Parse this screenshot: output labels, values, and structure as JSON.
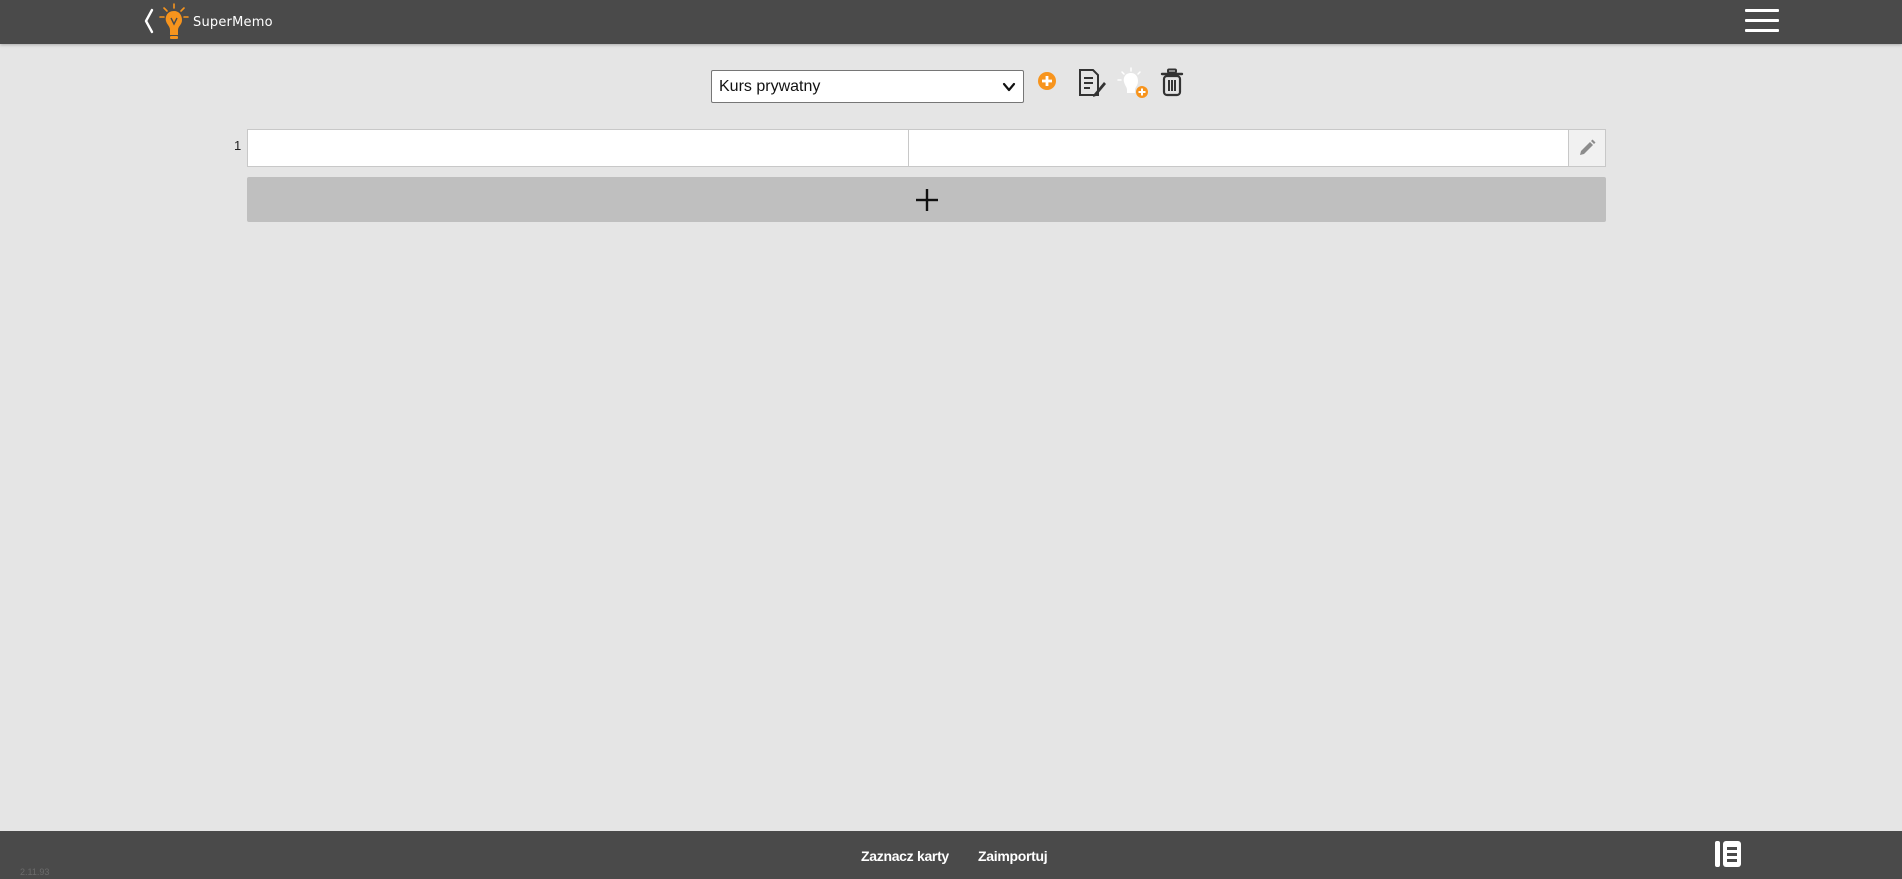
{
  "header": {
    "brand": "SuperMemo",
    "back_icon": "chevron-left-icon",
    "menu_icon": "hamburger-menu-icon"
  },
  "toolbar": {
    "course_select": {
      "selected": "Kurs prywatny",
      "options": [
        "Kurs prywatny"
      ]
    },
    "icons": [
      "add-course-icon",
      "edit-course-icon",
      "add-lightbulb-icon",
      "delete-course-icon"
    ]
  },
  "cards": {
    "rows": [
      {
        "number": "1",
        "front": "",
        "back": ""
      }
    ],
    "add_label": "+"
  },
  "footer": {
    "select_cards": "Zaznacz karty",
    "import": "Zaimportuj",
    "version": "2.11.93"
  },
  "colors": {
    "bar": "#4a4a4a",
    "background": "#e5e5e5",
    "accent": "#f7941d",
    "add_button": "#bfbfbf"
  }
}
